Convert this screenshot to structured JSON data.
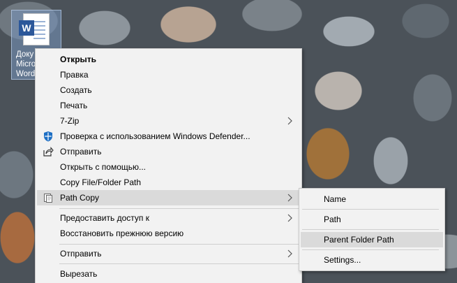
{
  "desktop": {
    "file_name_lines": [
      "Доку",
      "Micro",
      "Word"
    ]
  },
  "context_menu": {
    "items": [
      {
        "label": "Открыть",
        "bold": true
      },
      {
        "label": "Правка"
      },
      {
        "label": "Создать"
      },
      {
        "label": "Печать"
      },
      {
        "label": "7-Zip",
        "submenu": true
      },
      {
        "label": "Проверка с использованием Windows Defender...",
        "icon": "windows-defender-icon"
      },
      {
        "label": "Отправить",
        "icon": "share-icon"
      },
      {
        "label": "Открыть с помощью..."
      },
      {
        "label": "Copy File/Folder Path"
      },
      {
        "label": "Path Copy",
        "icon": "path-copy-icon",
        "submenu": true,
        "highlighted": true
      },
      {
        "label": "Предоставить доступ к",
        "submenu": true
      },
      {
        "label": "Восстановить прежнюю версию"
      },
      {
        "label": "Отправить",
        "submenu": true
      },
      {
        "label": "Вырезать"
      }
    ]
  },
  "path_copy_submenu": {
    "items": [
      {
        "label": "Name"
      },
      {
        "label": "Path"
      },
      {
        "label": "Parent Folder Path",
        "highlighted": true
      },
      {
        "label": "Settings..."
      }
    ]
  },
  "colors": {
    "menu_bg": "#f2f2f2",
    "hover_bg": "#dadada",
    "word_blue": "#2b579a"
  }
}
